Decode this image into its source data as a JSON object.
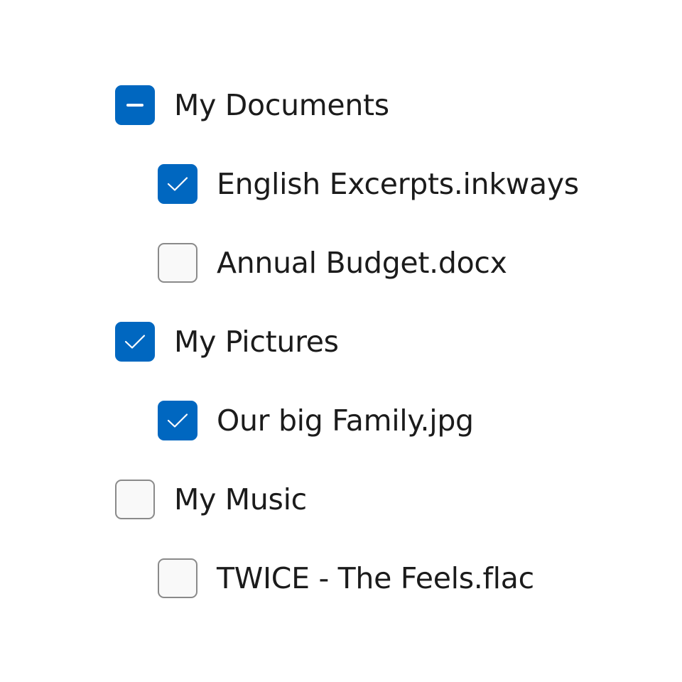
{
  "tree": {
    "items": [
      {
        "label": "My Documents",
        "state": "indeterminate",
        "level": 0
      },
      {
        "label": "English Excerpts.inkways",
        "state": "checked",
        "level": 1
      },
      {
        "label": "Annual Budget.docx",
        "state": "unchecked",
        "level": 1
      },
      {
        "label": "My Pictures",
        "state": "checked",
        "level": 0
      },
      {
        "label": "Our big Family.jpg",
        "state": "checked",
        "level": 1
      },
      {
        "label": "My Music",
        "state": "unchecked",
        "level": 0
      },
      {
        "label": "TWICE - The Feels.flac",
        "state": "unchecked",
        "level": 1
      }
    ]
  },
  "colors": {
    "accent": "#0067c0",
    "unchecked_border": "#8a8a8a",
    "unchecked_fill": "#f9f9f9",
    "text": "#1b1b1b"
  }
}
